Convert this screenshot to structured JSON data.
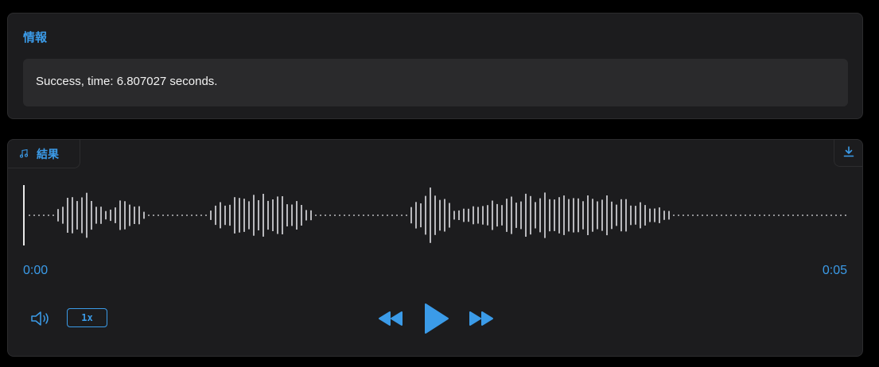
{
  "info": {
    "title": "情報",
    "message": "Success, time: 6.807027 seconds."
  },
  "audio": {
    "label": "結果",
    "current_time": "0:00",
    "duration": "0:05",
    "playback_progress": 0,
    "speed": "1x",
    "icons": {
      "tab": "music-note-icon",
      "download": "download-icon",
      "volume": "volume-icon",
      "rewind": "rewind-icon",
      "play": "play-icon",
      "forward": "fast-forward-icon"
    }
  },
  "colors": {
    "background": "#000000",
    "panel": "#1c1c1e",
    "accent": "#3b9be8",
    "waveform": "#b8b8bc",
    "text": "#f2f2f2"
  }
}
